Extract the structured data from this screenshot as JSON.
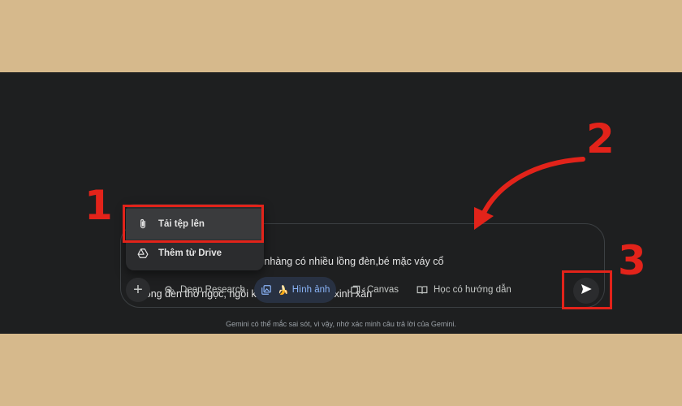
{
  "prompt": {
    "text_line1": "ng nền trung thu vàng nhẹ nhàng có nhiều lồng đèn,bé mặc váy cổ",
    "text_line2": "lồng đèn thỏ ngọc, ngồi kế bên có thỏ con xinh xắn"
  },
  "attach_menu": {
    "items": [
      {
        "label": "Tải tệp lên",
        "icon": "paperclip-icon"
      },
      {
        "label": "Thêm từ Drive",
        "icon": "google-drive-icon"
      }
    ]
  },
  "toolbar": {
    "plus_label": "+",
    "tools": [
      {
        "label": "Deep Research",
        "icon": "deep-research-icon"
      },
      {
        "label": "Hình ảnh",
        "icon": "image-gallery-icon",
        "emoji": "🍌",
        "active": true
      },
      {
        "label": "Canvas",
        "icon": "canvas-icon"
      },
      {
        "label": "Học có hướng dẫn",
        "icon": "guided-learning-icon"
      }
    ]
  },
  "send_button": {
    "icon": "send-icon"
  },
  "footer": {
    "disclaimer": "Gemini có thể mắc sai sót, vì vậy, nhớ xác minh câu trả lời của Gemini."
  },
  "annotations": {
    "step1": "1",
    "step2": "2",
    "step3": "3",
    "color": "#e2231a"
  },
  "colors": {
    "frame_background": "#d6b98c",
    "app_background": "#1e1f20",
    "active_tool": "#8ab4f8"
  }
}
